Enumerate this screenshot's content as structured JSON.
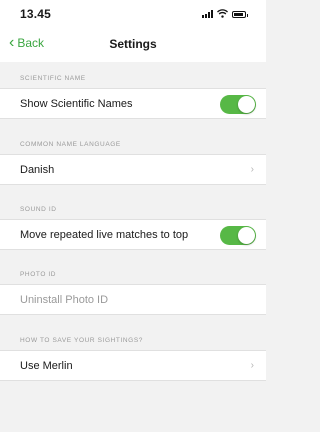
{
  "status_bar": {
    "time": "13.45",
    "icons": [
      "signal-icon",
      "wifi-icon",
      "battery-icon"
    ]
  },
  "nav": {
    "back_label": "Back",
    "title": "Settings"
  },
  "colors": {
    "accent": "#3aa640",
    "toggle_on": "#57b846",
    "background": "#f2f2f2"
  },
  "sections": {
    "scientific_name": {
      "header": "SCIENTIFIC NAME",
      "row_label": "Show Scientific Names",
      "toggle_on": true
    },
    "common_name_language": {
      "header": "COMMON NAME LANGUAGE",
      "row_label": "Danish"
    },
    "sound_id": {
      "header": "SOUND ID",
      "row_label": "Move repeated live matches to top",
      "toggle_on": true
    },
    "photo_id": {
      "header": "PHOTO ID",
      "row_label": "Uninstall Photo ID"
    },
    "save_sightings": {
      "header": "HOW TO SAVE YOUR SIGHTINGS?",
      "row_label": "Use Merlin"
    }
  }
}
